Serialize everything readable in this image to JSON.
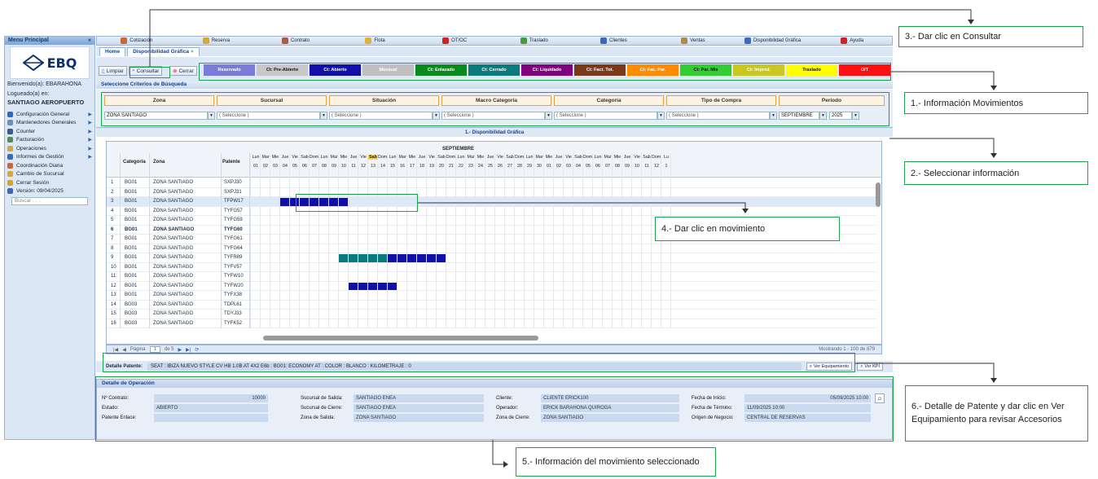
{
  "sidebar": {
    "title": "Menu Principal",
    "collapse": "«",
    "logo": "EBQ",
    "welcome": "Bienvenido(a): EBARAHONA",
    "logged": "Logueado(a) en:",
    "branch": "SANTIAGO AEROPUERTO",
    "menu": [
      {
        "label": "Configuración General",
        "icon": "gear-icon",
        "color": "#2a6ac8",
        "arrow": true
      },
      {
        "label": "Mantenedores Generales",
        "icon": "table-icon",
        "color": "#6a8fb8",
        "arrow": true
      },
      {
        "label": "Counter",
        "icon": "car-icon",
        "color": "#3b5b8c",
        "arrow": true
      },
      {
        "label": "Facturación",
        "icon": "invoice-icon",
        "color": "#5a8a5a",
        "arrow": true
      },
      {
        "label": "Operaciones",
        "icon": "folder-icon",
        "color": "#d8a63a",
        "arrow": true
      },
      {
        "label": "Informes de Gestión",
        "icon": "chart-icon",
        "color": "#3a6ab8",
        "arrow": true
      },
      {
        "label": "Coordinación Diaria",
        "icon": "people-icon",
        "color": "#c8683a",
        "arrow": false
      },
      {
        "label": "Cambio de Sucursal",
        "icon": "refresh-icon",
        "color": "#d8a63a",
        "arrow": false
      },
      {
        "label": "Cerrar Sesión",
        "icon": "lock-icon",
        "color": "#e0a020",
        "arrow": false
      },
      {
        "label": "Versión: 09/04/2025",
        "icon": "info-icon",
        "color": "#3a6ab8",
        "arrow": false
      }
    ],
    "search_placeholder": "Buscar . . ."
  },
  "topbar": [
    {
      "label": "Cotización",
      "color": "#c8683a"
    },
    {
      "label": "Reserva",
      "color": "#d8a63a"
    },
    {
      "label": "Contrato",
      "color": "#b05a3a"
    },
    {
      "label": "Flota",
      "color": "#e0b040"
    },
    {
      "label": "OT/OC",
      "color": "#cc2222"
    },
    {
      "label": "Traslado",
      "color": "#4a9a3a"
    },
    {
      "label": "Clientes",
      "color": "#3a6ab8"
    },
    {
      "label": "Ventas",
      "color": "#b08a4a"
    },
    {
      "label": "Disponibilidad Gráfica",
      "color": "#3a6ab8"
    },
    {
      "label": "Ayuda",
      "color": "#cc2222"
    }
  ],
  "tabs": [
    {
      "label": "Home"
    },
    {
      "label": "Disponibilidad Gráfica"
    }
  ],
  "toolbar": {
    "limpiar": "Limpiar",
    "consultar": "Consultar",
    "cerrar": "Cerrar"
  },
  "legend": [
    {
      "label": "Reservado",
      "bg": "#7b7bd8",
      "fg": "#fff"
    },
    {
      "label": "Ct: Pre-Abierto",
      "bg": "#c8c8c8",
      "fg": "#111"
    },
    {
      "label": "Ct: Abierto",
      "bg": "#1010a8",
      "fg": "#fff"
    },
    {
      "label": "Mensual",
      "bg": "#c0c0c0",
      "fg": "#fff"
    },
    {
      "label": "Ct: Enlazado",
      "bg": "#0a8a1a",
      "fg": "#fff"
    },
    {
      "label": "Ct: Cerrado",
      "bg": "#0a7a7a",
      "fg": "#fff"
    },
    {
      "label": "Ct: Liquidado",
      "bg": "#800080",
      "fg": "#fff"
    },
    {
      "label": "Ct: Fact. Tot.",
      "bg": "#7a3a1a",
      "fg": "#fff"
    },
    {
      "label": "Ct: Fac. Par.",
      "bg": "#ff8c00",
      "fg": "#fff"
    },
    {
      "label": "Ct: Par. Mix",
      "bg": "#32cd32",
      "fg": "#111"
    },
    {
      "label": "Ct: Impred.",
      "bg": "#c8c820",
      "fg": "#fff"
    },
    {
      "label": "Traslado",
      "bg": "#ffff00",
      "fg": "#111"
    },
    {
      "label": "O/T",
      "bg": "#ff1010",
      "fg": "#fff"
    }
  ],
  "criteria_title": "Seleccione Criterios de Búsqueda",
  "filters": {
    "headers": [
      "Zona",
      "Sucursal",
      "Situación",
      "Macro Categoría",
      "Categoría",
      "Tipo de Compra",
      "Período"
    ],
    "zona": "ZONA SANTIAGO",
    "sel": "( Seleccione )",
    "mes": "SEPTIEMBRE",
    "anio": "2025"
  },
  "dispo_title": "1.- Disponibilidad Gráfica",
  "grid": {
    "headers": {
      "categoria": "Categoría",
      "zona": "Zona",
      "patente": "Patente"
    },
    "month": "SEPTIEMBRE",
    "days": [
      "Lun",
      "Mar",
      "Mie",
      "Jue",
      "Vie",
      "Sab",
      "Dom.",
      "Lun",
      "Mar",
      "Mie",
      "Jue",
      "Vie",
      "Sab",
      "Dom.",
      "Lun",
      "Mar",
      "Mie",
      "Jue",
      "Vie",
      "Sab",
      "Dom.",
      "Lun",
      "Mar",
      "Mie",
      "Jue",
      "Vie",
      "Sab",
      "Dom.",
      "Lun",
      "Mar",
      "Mie",
      "Jue",
      "Vie",
      "Sab",
      "Dom.",
      "Lun",
      "Mar",
      "Mie",
      "Jue",
      "Vie",
      "Sab",
      "Dom.",
      "Lu"
    ],
    "dates": [
      "01",
      "02",
      "03",
      "04",
      "05",
      "06",
      "07",
      "08",
      "09",
      "10",
      "11",
      "12",
      "13",
      "14",
      "15",
      "16",
      "17",
      "18",
      "19",
      "20",
      "21",
      "22",
      "23",
      "24",
      "25",
      "26",
      "27",
      "28",
      "29",
      "30",
      "01",
      "02",
      "03",
      "04",
      "05",
      "06",
      "07",
      "08",
      "09",
      "10",
      "11",
      "12",
      "1"
    ],
    "rows": [
      {
        "n": "1",
        "cat": "BG01",
        "zona": "ZONA SANTIAGO",
        "pat": "SXPJ30"
      },
      {
        "n": "2",
        "cat": "BG01",
        "zona": "ZONA SANTIAGO",
        "pat": "SXPJ31"
      },
      {
        "n": "3",
        "cat": "BG01",
        "zona": "ZONA SANTIAGO",
        "pat": "TFPW17"
      },
      {
        "n": "4",
        "cat": "BG01",
        "zona": "ZONA SANTIAGO",
        "pat": "TYFG57"
      },
      {
        "n": "5",
        "cat": "BG01",
        "zona": "ZONA SANTIAGO",
        "pat": "TYFG59"
      },
      {
        "n": "6",
        "cat": "BG01",
        "zona": "ZONA SANTIAGO",
        "pat": "TYFG60"
      },
      {
        "n": "7",
        "cat": "BG01",
        "zona": "ZONA SANTIAGO",
        "pat": "TYFG61"
      },
      {
        "n": "8",
        "cat": "BG01",
        "zona": "ZONA SANTIAGO",
        "pat": "TYFG64"
      },
      {
        "n": "9",
        "cat": "BG01",
        "zona": "ZONA SANTIAGO",
        "pat": "TYFR89"
      },
      {
        "n": "10",
        "cat": "BG01",
        "zona": "ZONA SANTIAGO",
        "pat": "TYFV57"
      },
      {
        "n": "11",
        "cat": "BG01",
        "zona": "ZONA SANTIAGO",
        "pat": "TYFW10"
      },
      {
        "n": "12",
        "cat": "BG01",
        "zona": "ZONA SANTIAGO",
        "pat": "TYFW20"
      },
      {
        "n": "13",
        "cat": "BG01",
        "zona": "ZONA SANTIAGO",
        "pat": "TYFX38"
      },
      {
        "n": "14",
        "cat": "BG03",
        "zona": "ZONA SANTIAGO",
        "pat": "TDPL61"
      },
      {
        "n": "15",
        "cat": "BG03",
        "zona": "ZONA SANTIAGO",
        "pat": "TDYJ33"
      },
      {
        "n": "16",
        "cat": "BG03",
        "zona": "ZONA SANTIAGO",
        "pat": "TYFK52"
      }
    ],
    "selected_row": 3,
    "bold_row": 6,
    "bars": [
      {
        "row": 3,
        "from": 4,
        "to": 10,
        "color": "#1010a8"
      },
      {
        "row": 9,
        "from": 10,
        "to": 14,
        "color": "#0a7a7a"
      },
      {
        "row": 9,
        "from": 15,
        "to": 20,
        "color": "#1010a8"
      },
      {
        "row": 12,
        "from": 11,
        "to": 15,
        "color": "#1010a8"
      }
    ]
  },
  "pager": {
    "pagina": "Página",
    "page": "1",
    "de": "de 5",
    "showing": "Mostrando 1 - 100 de 879"
  },
  "detalle_patente": {
    "label": "Detalle Patente:",
    "value": "SEAT : IBIZA NUEVO STYLE CV HB 1.0B AT 4X2 E6b : BG01: ECONOMY AT : COLOR : BLANCO : KILOMETRAJE : 0",
    "ver_equip": "Ver Equipamiento",
    "ver_kpi": "Ver KPI"
  },
  "detalle_op": {
    "title": "Detalle de Operación",
    "fields": [
      {
        "label": "Nº Contrato:",
        "value": "10000"
      },
      {
        "label": "Estado:",
        "value": "ABIERTO"
      },
      {
        "label": "Patente Enlace:",
        "value": ""
      },
      {
        "label": "Sucursal de Salida:",
        "value": "SANTIAGO ENEA"
      },
      {
        "label": "Sucursal de Cierre:",
        "value": "SANTIAGO ENEA"
      },
      {
        "label": "Zona de Salida:",
        "value": "ZONA SANTIAGO"
      },
      {
        "label": "Cliente:",
        "value": "CLIENTE ERICK100"
      },
      {
        "label": "Operador:",
        "value": "ERICK BARAHONA QUIROGA"
      },
      {
        "label": "Zona de Cierre:",
        "value": "ZONA SANTIAGO"
      },
      {
        "label": "Fecha de Inicio:",
        "value": "05/09/2025 10:00"
      },
      {
        "label": "Fecha de Término:",
        "value": "11/09/2025 10:00"
      },
      {
        "label": "Origen de Negocio:",
        "value": "CENTRAL DE RESERVAS"
      }
    ]
  },
  "callouts": {
    "c3": "3.- Dar clic en Consultar",
    "c1": "1.- Información Movimientos",
    "c2": "2.- Seleccionar información",
    "c4": "4.- Dar clic en movimiento",
    "c6": "6.- Detalle de Patente y dar clic en Ver Equipamiento para revisar Accesorios",
    "c5": "5.- Información del movimiento seleccionado"
  }
}
